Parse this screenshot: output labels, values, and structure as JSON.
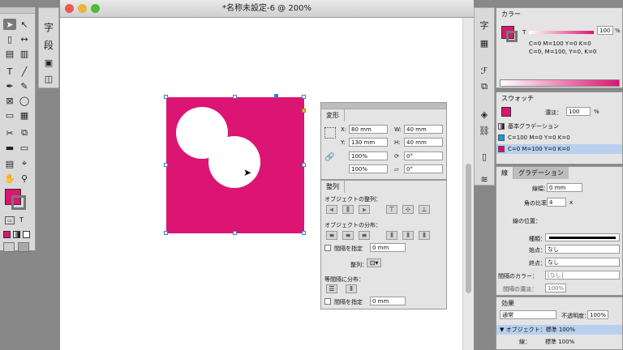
{
  "document": {
    "title": "*名称未設定-6 @ 200%"
  },
  "toolbox": {
    "tools": [
      "selection-tool",
      "direct-selection-tool",
      "page-tool",
      "gap-tool",
      "content-collector-tool",
      "content-placer-tool",
      "type-tool",
      "line-tool",
      "pen-tool",
      "pencil-tool",
      "rectangle-frame-tool",
      "ellipse-tool",
      "rectangle-tool",
      "table-tool",
      "scissors-tool",
      "free-transform-tool",
      "gradient-swatch-tool",
      "gradient-feather-tool",
      "note-tool",
      "eyedropper-tool",
      "hand-tool",
      "zoom-tool"
    ],
    "fill_color": "#dc1473",
    "text_mode_label": "T"
  },
  "strip2": {
    "items": [
      "字",
      "段"
    ]
  },
  "transform_panel": {
    "tab": "変形",
    "x_label": "X:",
    "x_value": "80 mm",
    "y_label": "Y:",
    "y_value": "130 mm",
    "w_label": "W:",
    "w_value": "40 mm",
    "h_label": "H:",
    "h_value": "40 mm",
    "scale_x": "100%",
    "scale_y": "100%",
    "rotate": "0°",
    "shear": "0°"
  },
  "align_panel": {
    "tab": "整列",
    "section1": "オブジェクトの整列：",
    "section2": "オブジェクトの分布：",
    "spacing_label": "間隔を指定",
    "spacing_value": "0 mm",
    "align_to_label": "整列：",
    "section3": "等間隔に分布：",
    "spacing_label2": "間隔を指定",
    "spacing_value2": "0 mm"
  },
  "color_panel": {
    "tab": "カラー",
    "t_label": "T",
    "tint_value": "100",
    "tint_unit": "%",
    "line1": "C=0 M=100 Y=0 K=0",
    "line2": "C=0, M=100, Y=0, K=0"
  },
  "swatch_panel": {
    "tab": "スウォッチ",
    "tint_label": "濃淡：",
    "tint_value": "100",
    "tint_unit": "%",
    "rows": [
      {
        "label": "基本グラデーション",
        "color": "#888888"
      },
      {
        "label": "C=100 M=0 Y=0 K=0",
        "color": "#00a0e9"
      },
      {
        "label": "C=0 M=100 Y=0 K=0",
        "color": "#e4007f"
      }
    ]
  },
  "stroke_panel": {
    "tab1": "線",
    "tab2": "グラデーション",
    "weight_label": "線幅：",
    "weight_value": "0 mm",
    "miter_label": "角の比率：",
    "miter_value": "4",
    "miter_unit": "x",
    "align_label": "線の位置：",
    "type_label": "種類：",
    "start_label": "始点：",
    "start_value": "なし",
    "end_label": "終点：",
    "end_value": "なし",
    "gap_color_label": "間隔のカラー：",
    "gap_color_value": "[なし]",
    "gap_tint_label": "間隔の濃淡：",
    "gap_tint_value": "100%"
  },
  "effects_panel": {
    "tab": "効果",
    "blend_mode": "通常",
    "opacity_label": "不透明度：",
    "opacity_value": "100%",
    "object_row": "▼ オブジェクト：標準 100%",
    "stroke_row_label": "線：",
    "stroke_row_value": "標準 100%"
  }
}
